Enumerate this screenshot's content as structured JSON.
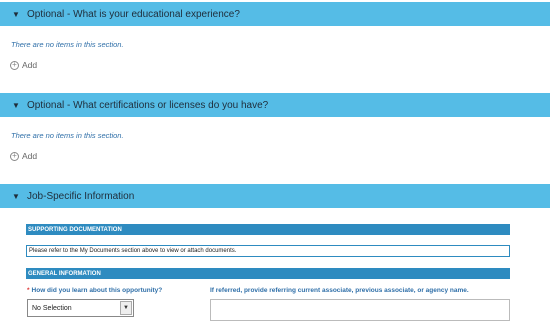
{
  "sections": [
    {
      "title": "Optional - What is your educational experience?",
      "empty_text": "There are no items in this section.",
      "add_label": "Add"
    },
    {
      "title": "Optional - What certifications or licenses do you have?",
      "empty_text": "There are no items in this section.",
      "add_label": "Add"
    },
    {
      "title": "Job-Specific Information"
    }
  ],
  "job_specific": {
    "supporting_heading": "SUPPORTING DOCUMENTATION",
    "documents_notice": "Please refer to the My Documents section above to view or attach documents.",
    "general_heading": "GENERAL INFORMATION",
    "how_learned_label": "How did you learn about this opportunity?",
    "how_learned_value": "No Selection",
    "referral_label": "If referred, provide referring current associate, previous associate, or agency name.",
    "required_marker": "*"
  },
  "icons": {
    "caret": "caret-down-icon",
    "add": "plus-circle-icon",
    "select_arrow": "chevron-down-icon"
  },
  "colors": {
    "section_header": "#55bce6",
    "band": "#2e8bc0",
    "link_text": "#2f6fa8"
  }
}
